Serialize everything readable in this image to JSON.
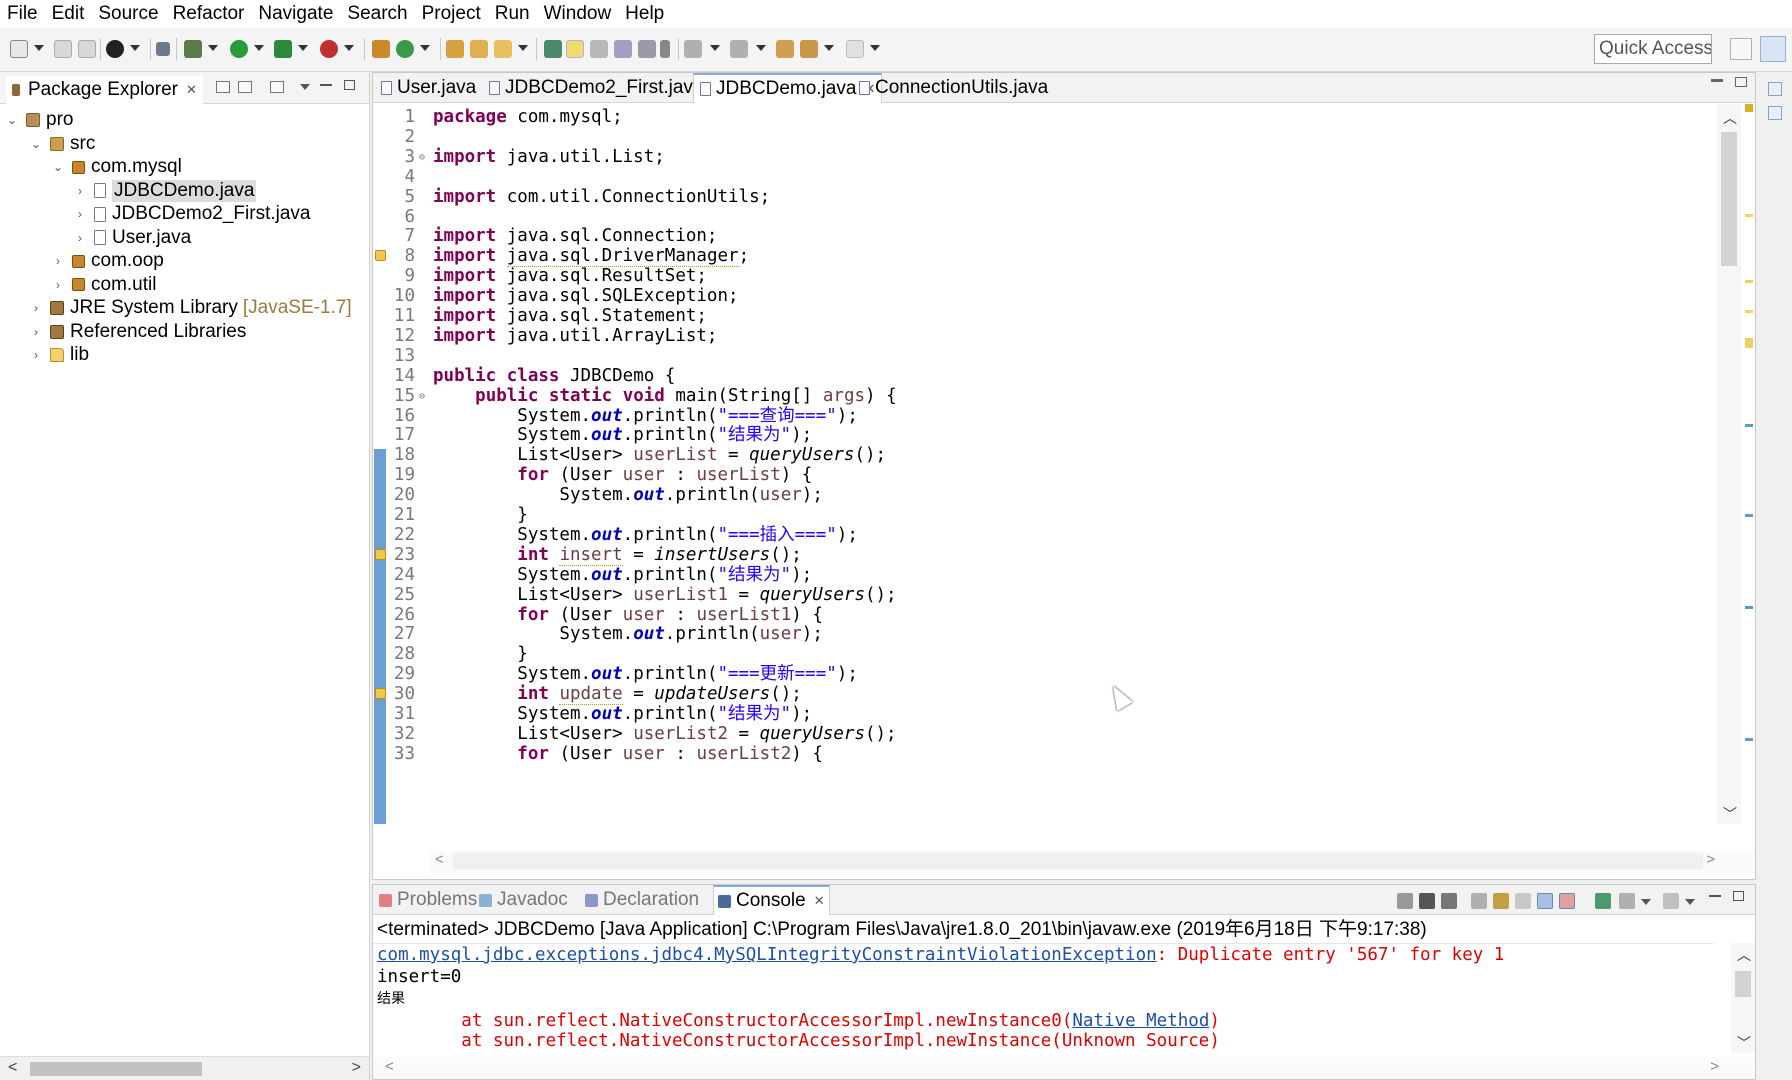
{
  "menu": [
    "File",
    "Edit",
    "Source",
    "Refactor",
    "Navigate",
    "Search",
    "Project",
    "Run",
    "Window",
    "Help"
  ],
  "toolbar": {
    "quick_access": "Quick Access"
  },
  "package_explorer": {
    "title": "Package Explorer",
    "tree": [
      {
        "label": "pro",
        "depth": 0,
        "expanded": true,
        "icon": "project-icon"
      },
      {
        "label": "src",
        "depth": 1,
        "expanded": true,
        "icon": "source-folder-icon"
      },
      {
        "label": "com.mysql",
        "depth": 2,
        "expanded": true,
        "icon": "package-icon"
      },
      {
        "label": "JDBCDemo.java",
        "depth": 3,
        "expanded": false,
        "icon": "java-file-icon",
        "selected": true
      },
      {
        "label": "JDBCDemo2_First.java",
        "depth": 3,
        "expanded": false,
        "icon": "java-file-icon"
      },
      {
        "label": "User.java",
        "depth": 3,
        "expanded": false,
        "icon": "java-file-icon"
      },
      {
        "label": "com.oop",
        "depth": 2,
        "expanded": false,
        "icon": "package-icon"
      },
      {
        "label": "com.util",
        "depth": 2,
        "expanded": false,
        "icon": "package-icon"
      },
      {
        "label": "JRE System Library",
        "extra": "[JavaSE-1.7]",
        "depth": 1,
        "expanded": false,
        "icon": "library-icon"
      },
      {
        "label": "Referenced Libraries",
        "depth": 1,
        "expanded": false,
        "icon": "library-icon"
      },
      {
        "label": "lib",
        "depth": 1,
        "expanded": false,
        "icon": "folder-icon"
      }
    ]
  },
  "editor": {
    "tabs": [
      {
        "label": "User.java",
        "active": false
      },
      {
        "label": "JDBCDemo2_First.java",
        "active": false
      },
      {
        "label": "JDBCDemo.java",
        "active": true
      },
      {
        "label": "ConnectionUtils.java",
        "active": false
      }
    ],
    "lines": [
      {
        "n": "1",
        "html": "<span class=\"kw\">package</span> com.mysql;"
      },
      {
        "n": "2",
        "html": ""
      },
      {
        "n": "3",
        "html": "<span class=\"kw\">import</span> java.util.List;",
        "fold": true
      },
      {
        "n": "4",
        "html": ""
      },
      {
        "n": "5",
        "html": "<span class=\"kw\">import</span> com.util.ConnectionUtils;"
      },
      {
        "n": "6",
        "html": ""
      },
      {
        "n": "7",
        "html": "<span class=\"kw\">import</span> java.sql.Connection;"
      },
      {
        "n": "8",
        "html": "<span class=\"kw\">import</span> <span class=\"warn\">java.sql.DriverManager</span>;",
        "marker": true
      },
      {
        "n": "9",
        "html": "<span class=\"kw\">import</span> java.sql.ResultSet;"
      },
      {
        "n": "10",
        "html": "<span class=\"kw\">import</span> java.sql.SQLException;"
      },
      {
        "n": "11",
        "html": "<span class=\"kw\">import</span> java.sql.Statement;"
      },
      {
        "n": "12",
        "html": "<span class=\"kw\">import</span> java.util.ArrayList;"
      },
      {
        "n": "13",
        "html": ""
      },
      {
        "n": "14",
        "html": "<span class=\"kw\">public</span> <span class=\"kw\">class</span> JDBCDemo {"
      },
      {
        "n": "15",
        "html": "    <span class=\"kw\">public</span> <span class=\"kw\">static</span> <span class=\"kw\">void</span> main(String[] <span class=\"var\">args</span>) {",
        "fold": true
      },
      {
        "n": "16",
        "html": "        System.<span class=\"fld\">out</span>.println(<span class=\"str\">\"===查询===\"</span>);"
      },
      {
        "n": "17",
        "html": "        System.<span class=\"fld\">out</span>.println(<span class=\"str\">\"结果为\"</span>);"
      },
      {
        "n": "18",
        "html": "        List&lt;User&gt; <span class=\"var\">userList</span> = <span class=\"mth\">queryUsers</span>();"
      },
      {
        "n": "19",
        "html": "        <span class=\"kw\">for</span> (User <span class=\"var\">user</span> : <span class=\"var\">userList</span>) {"
      },
      {
        "n": "20",
        "html": "            System.<span class=\"fld\">out</span>.println(<span class=\"var\">user</span>);"
      },
      {
        "n": "21",
        "html": "        }"
      },
      {
        "n": "22",
        "html": "        System.<span class=\"fld\">out</span>.println(<span class=\"str\">\"===插入===\"</span>);"
      },
      {
        "n": "23",
        "html": "        <span class=\"kw\">int</span> <span class=\"var warn\">insert</span> = <span class=\"mth\">insertUsers</span>();",
        "marker": true
      },
      {
        "n": "24",
        "html": "        System.<span class=\"fld\">out</span>.println(<span class=\"str\">\"结果为\"</span>);"
      },
      {
        "n": "25",
        "html": "        List&lt;User&gt; <span class=\"var\">userList1</span> = <span class=\"mth\">queryUsers</span>();"
      },
      {
        "n": "26",
        "html": "        <span class=\"kw\">for</span> (User <span class=\"var\">user</span> : <span class=\"var\">userList1</span>) {"
      },
      {
        "n": "27",
        "html": "            System.<span class=\"fld\">out</span>.println(<span class=\"var\">user</span>);"
      },
      {
        "n": "28",
        "html": "        }"
      },
      {
        "n": "29",
        "html": "        System.<span class=\"fld\">out</span>.println(<span class=\"str\">\"===更新===\"</span>);"
      },
      {
        "n": "30",
        "html": "        <span class=\"kw\">int</span> <span class=\"var warn\">update</span> = <span class=\"mth\">updateUsers</span>();",
        "marker": true
      },
      {
        "n": "31",
        "html": "        System.<span class=\"fld\">out</span>.println(<span class=\"str\">\"结果为\"</span>);"
      },
      {
        "n": "32",
        "html": "        List&lt;User&gt; <span class=\"var\">userList2</span> = <span class=\"mth\">queryUsers</span>();"
      },
      {
        "n": "33",
        "html": "        <span class=\"kw\">for</span> (User <span class=\"var\">user</span> : <span class=\"var\">userList2</span>) {"
      }
    ]
  },
  "console": {
    "tabs": [
      {
        "label": "Problems",
        "active": false
      },
      {
        "label": "Javadoc",
        "active": false
      },
      {
        "label": "Declaration",
        "active": false
      },
      {
        "label": "Console",
        "active": true
      }
    ],
    "status": "<terminated> JDBCDemo [Java Application] C:\\Program Files\\Java\\jre1.8.0_201\\bin\\javaw.exe (2019年6月18日 下午9:17:38)",
    "output": {
      "exception_class": "com.mysql.jdbc.exceptions.jdbc4.MySQLIntegrityConstraintViolationException",
      "exception_message": ": Duplicate entry '567' for key 1",
      "insert_line": "insert=0",
      "result_line": "结果",
      "trace1_prefix": "\tat sun.reflect.NativeConstructorAccessorImpl.newInstance0(",
      "trace1_link": "Native Method",
      "trace1_suffix": ")",
      "trace2": "\tat sun.reflect.NativeConstructorAccessorImpl.newInstance(Unknown Source)"
    }
  }
}
